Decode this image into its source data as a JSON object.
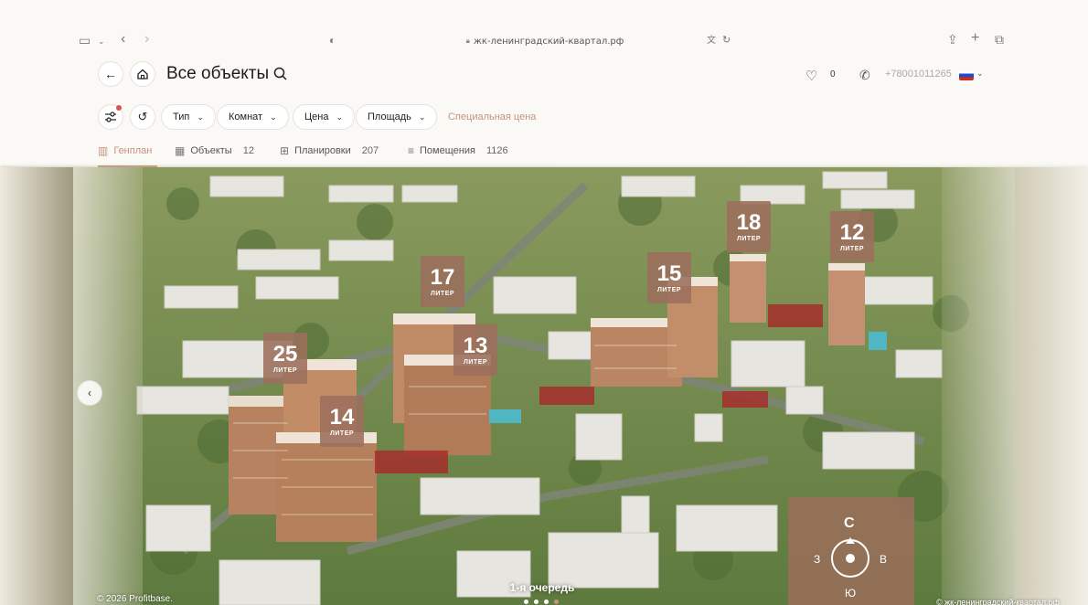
{
  "browser": {
    "url": "жк-ленинградский-квартал.рф"
  },
  "header": {
    "title": "Все объекты",
    "favorites_count": "0",
    "phone": "+78001011265"
  },
  "filters": {
    "items": [
      {
        "label": "Тип"
      },
      {
        "label": "Комнат"
      },
      {
        "label": "Цена"
      },
      {
        "label": "Площадь"
      }
    ],
    "special_price": "Специальная цена"
  },
  "tabs": [
    {
      "label": "Генплан",
      "count": "",
      "active": true
    },
    {
      "label": "Объекты",
      "count": "12"
    },
    {
      "label": "Планировки",
      "count": "207"
    },
    {
      "label": "Помещения",
      "count": "1126"
    }
  ],
  "map": {
    "liters": [
      {
        "num": "17",
        "label": "ЛИТЕР"
      },
      {
        "num": "15",
        "label": "ЛИТЕР"
      },
      {
        "num": "18",
        "label": "ЛИТЕР"
      },
      {
        "num": "12",
        "label": "ЛИТЕР"
      },
      {
        "num": "25",
        "label": "ЛИТЕР"
      },
      {
        "num": "13",
        "label": "ЛИТЕР"
      },
      {
        "num": "14",
        "label": "ЛИТЕР"
      }
    ],
    "compass": {
      "n": "С",
      "s": "Ю",
      "w": "З",
      "e": "В"
    },
    "queue_label": "1-я очередь",
    "copyright": "© 2026 Profitbase.",
    "domain": "© жк-ленинградский-квартал.рф"
  }
}
